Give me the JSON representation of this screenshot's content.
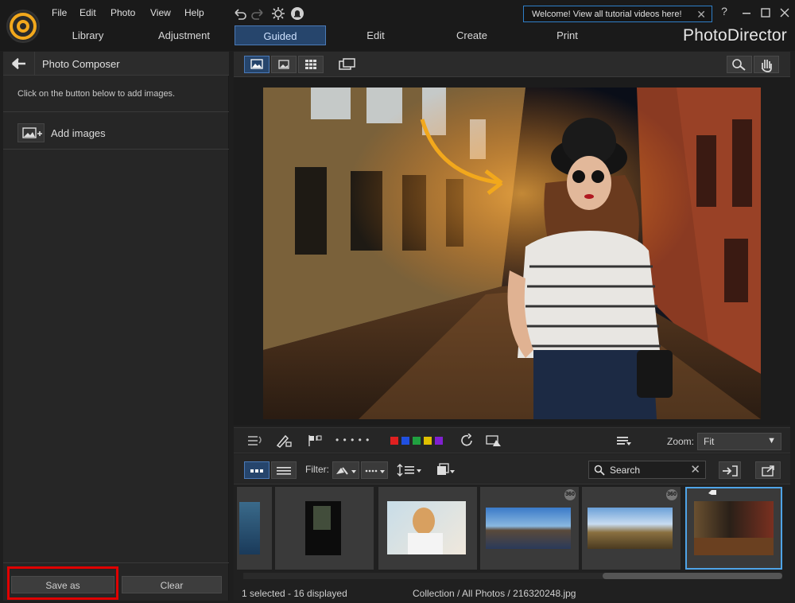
{
  "app": {
    "name": "PhotoDirector",
    "menu": [
      "File",
      "Edit",
      "Photo",
      "View",
      "Help"
    ],
    "welcome_banner": "Welcome! View all tutorial videos here!",
    "help_glyph": "?",
    "module_tabs": [
      "Library",
      "Adjustment",
      "Guided",
      "Edit",
      "Create",
      "Print"
    ],
    "active_tab": "Guided",
    "accent_color": "#4a7ab8"
  },
  "left_panel": {
    "title": "Photo Composer",
    "hint": "Click on the button below to add images.",
    "add_images_label": "Add images",
    "save_as_label": "Save as",
    "clear_label": "Clear",
    "highlight_color": "#e00000"
  },
  "toolbar": {
    "zoom_label": "Zoom:",
    "zoom_value": "Fit",
    "rating_dots": "• • • • •",
    "color_labels": [
      "#e02020",
      "#2050e0",
      "#20a040",
      "#e0c000",
      "#8020d0"
    ]
  },
  "filter_bar": {
    "filter_label": "Filter:",
    "search_placeholder": "Search"
  },
  "filmstrip": {
    "thumbs": [
      {
        "name": "water",
        "badge": ""
      },
      {
        "name": "dark-window",
        "badge": ""
      },
      {
        "name": "woman-portrait",
        "badge": ""
      },
      {
        "name": "panorama-rocks",
        "badge": "360"
      },
      {
        "name": "panorama-sky",
        "badge": "360"
      },
      {
        "name": "night-street",
        "badge": ""
      }
    ]
  },
  "status": {
    "selection": "1 selected - 16 displayed",
    "path": "Collection / All Photos / 216320248.jpg"
  }
}
